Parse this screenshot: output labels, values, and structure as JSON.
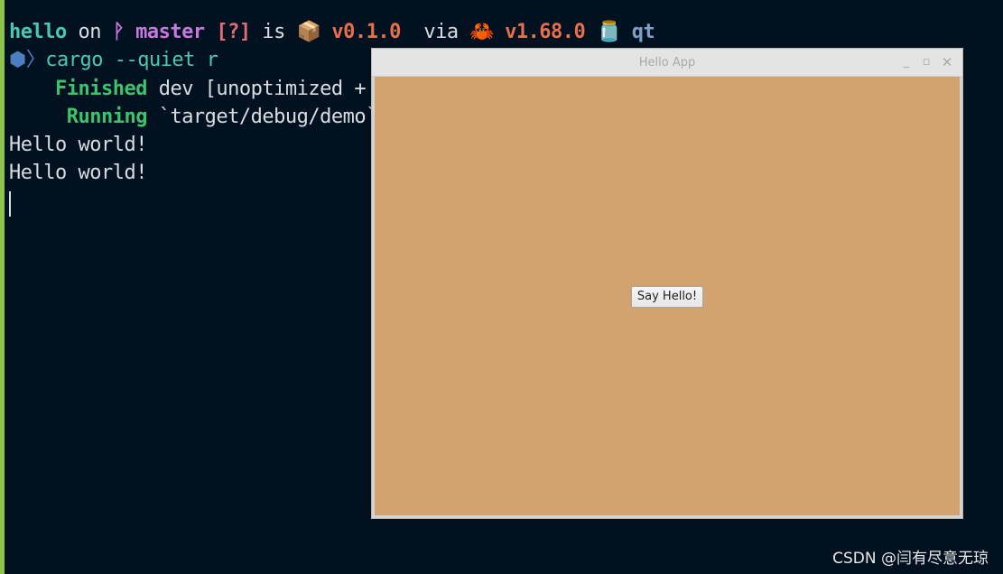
{
  "terminal": {
    "prompt": {
      "dir": "hello",
      "on": " on ",
      "git_icon": "ᚹ",
      "branch": " master ",
      "status": "[?]",
      "is": " is ",
      "package_emoji": "📦",
      "package_version": " v0.1.0 ",
      "via": " via ",
      "rust_emoji": "🦀",
      "rust_version": " v1.68.0 ",
      "jar_emoji": "🫙",
      "env": " qt"
    },
    "command_line": {
      "hex_icon": "⬢",
      "chevron": "〉",
      "command": "cargo --quiet r"
    },
    "finished_line": {
      "keyword": "    Finished",
      "text": " dev [unoptimized + d"
    },
    "running_line": {
      "keyword": "     Running",
      "text": " `target/debug/demo`"
    },
    "output": [
      "Hello world!",
      "Hello world!"
    ],
    "colors": {
      "background": "#021120",
      "border_accent": "#8fc24a",
      "teal": "#48c9b0",
      "purple": "#c678dd",
      "red": "#e06c75",
      "orange": "#e5704b",
      "green": "#3bc46b"
    }
  },
  "qt_window": {
    "title": "Hello App",
    "controls": {
      "minimize": "_",
      "maximize": "▫",
      "close": "✕"
    },
    "button_label": "Say Hello!",
    "client_color": "#d2a36f"
  },
  "watermark": "CSDN @闫有尽意无琼"
}
